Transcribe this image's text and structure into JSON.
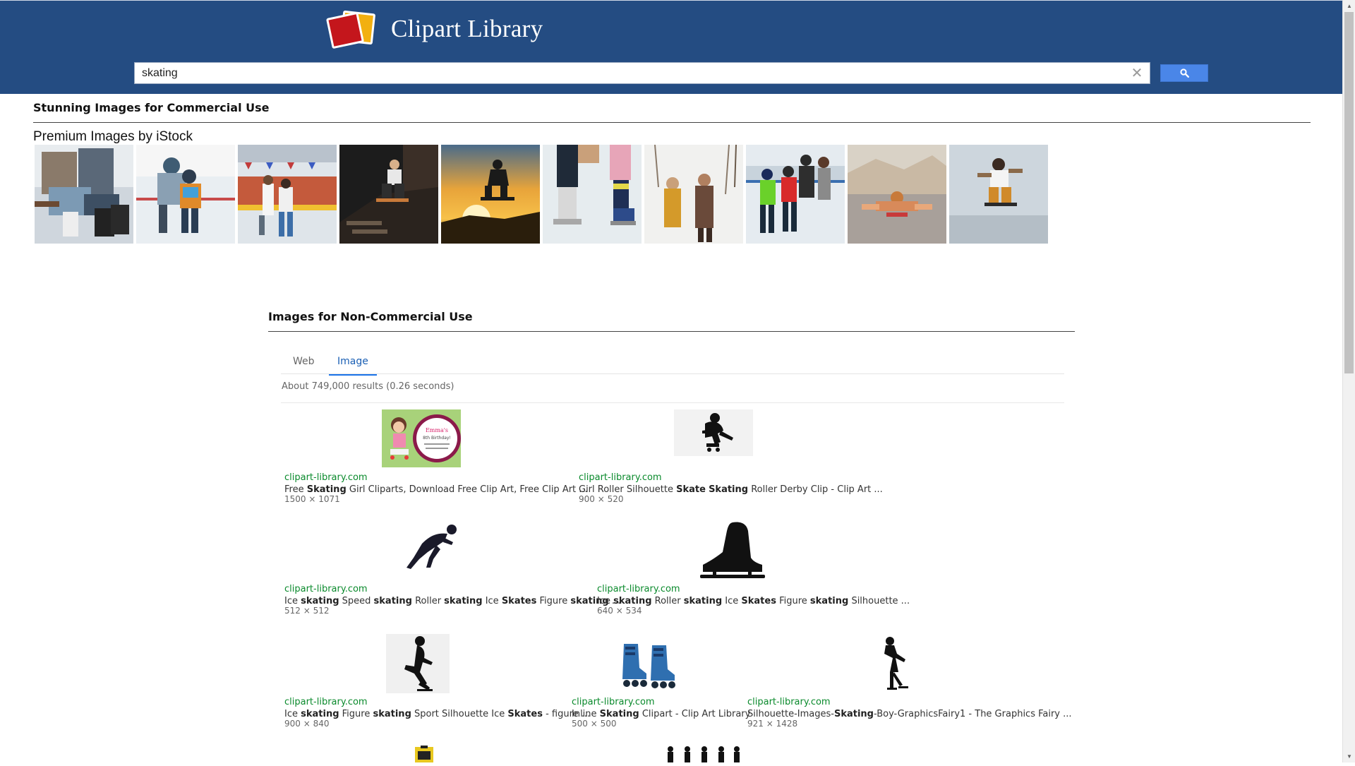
{
  "header": {
    "logo_text": "Clipart Library",
    "search": {
      "value": "skating",
      "clear_icon": "close-icon",
      "button_icon": "search-icon"
    }
  },
  "commercial": {
    "title": "Stunning Images for Commercial Use",
    "istock_label": "Premium Images by iStock",
    "thumbnails": [
      {
        "name": "istock-thumb-1",
        "icon": "photo-skater-lacing"
      },
      {
        "name": "istock-thumb-2",
        "icon": "photo-child-ice-skating"
      },
      {
        "name": "istock-thumb-3",
        "icon": "photo-family-rink"
      },
      {
        "name": "istock-thumb-4",
        "icon": "photo-skateboard-rail"
      },
      {
        "name": "istock-thumb-5",
        "icon": "photo-skateboard-sunset"
      },
      {
        "name": "istock-thumb-6",
        "icon": "photo-skates-closeup"
      },
      {
        "name": "istock-thumb-7",
        "icon": "photo-couple-winter"
      },
      {
        "name": "istock-thumb-8",
        "icon": "photo-family-rink-2"
      },
      {
        "name": "istock-thumb-9",
        "icon": "photo-skate-kids-road"
      },
      {
        "name": "istock-thumb-10",
        "icon": "photo-skateboard-jump"
      }
    ]
  },
  "noncommercial": {
    "title": "Images for Non-Commercial Use",
    "tabs": {
      "web": "Web",
      "image": "Image"
    },
    "results_info": "About 749,000 results (0.26 seconds)",
    "results": [
      {
        "domain": "clipart-library.com",
        "title_parts": [
          "Free ",
          "Skating",
          " Girl Cliparts, Download Free Clip Art, Free Clip Art ..."
        ],
        "dims": "1500 × 1071"
      },
      {
        "domain": "clipart-library.com",
        "title_parts": [
          "Girl Roller Silhouette ",
          "Skate",
          " ",
          "Skating",
          " Roller Derby Clip - Clip Art ..."
        ],
        "dims": "900 × 520"
      },
      {
        "domain": "clipart-library.com",
        "title_parts": [
          "Ice ",
          "skating",
          " Speed ",
          "skating",
          " Roller ",
          "skating",
          " Ice ",
          "Skates",
          " Figure ",
          "skating",
          " ..."
        ],
        "dims": "512 × 512"
      },
      {
        "domain": "clipart-library.com",
        "title_parts": [
          "Ice ",
          "skating",
          " Roller ",
          "skating",
          " Ice ",
          "Skates",
          " Figure ",
          "skating",
          " Silhouette ..."
        ],
        "dims": "640 × 534"
      },
      {
        "domain": "clipart-library.com",
        "title_parts": [
          "Ice ",
          "skating",
          " Figure ",
          "skating",
          " Sport Silhouette Ice ",
          "Skates",
          " - figure ..."
        ],
        "dims": "900 × 840"
      },
      {
        "domain": "clipart-library.com",
        "title_parts": [
          "Inline ",
          "Skating",
          " Clipart - Clip Art Library"
        ],
        "dims": "500 × 500"
      },
      {
        "domain": "clipart-library.com",
        "title_parts": [
          "Silhouette-Images-",
          "Skating",
          "-Boy-GraphicsFairy1 - The Graphics Fairy ..."
        ],
        "dims": "921 × 1428"
      }
    ]
  },
  "colors": {
    "header_bg": "#244c82",
    "search_button": "#4a86e8",
    "domain_green": "#0a8a2c",
    "tab_active": "#1a73e8"
  }
}
